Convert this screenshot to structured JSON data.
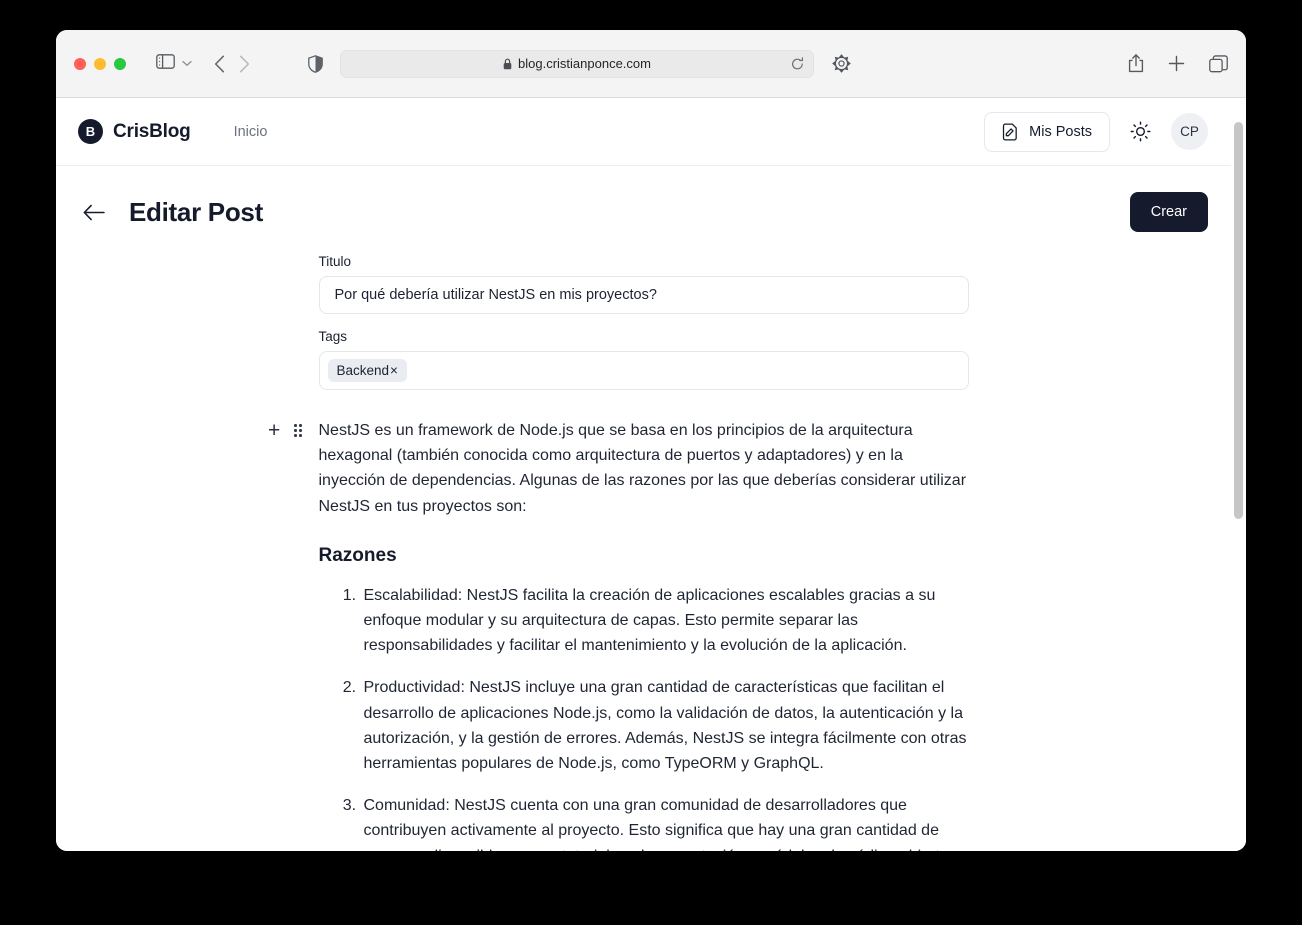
{
  "browser": {
    "url": "blog.cristianponce.com",
    "icons": {
      "sidebar": "sidebar-toggle-icon",
      "chevron": "chevron-down-icon",
      "back": "back-arrow-icon",
      "forward": "forward-arrow-icon",
      "shield": "shield-privacy-icon",
      "lock": "lock-icon",
      "reload": "reload-icon",
      "gear": "gear-icon",
      "share": "share-icon",
      "new_tab": "plus-icon",
      "tabs": "tabs-overview-icon"
    }
  },
  "site_header": {
    "brand_badge": "B",
    "brand_name": "CrisBlog",
    "nav_link": "Inicio",
    "my_posts_label": "Mis Posts",
    "theme_icon": "sun-icon",
    "avatar_initials": "CP"
  },
  "page": {
    "title": "Editar Post",
    "create_button": "Crear"
  },
  "form": {
    "title_label": "Titulo",
    "title_value": "Por qué debería utilizar NestJS en mis proyectos?",
    "tags_label": "Tags",
    "tags": [
      {
        "label": "Backend",
        "remove": "×"
      }
    ]
  },
  "editor": {
    "add_block": "+",
    "intro_paragraph": "NestJS es un framework de Node.js que se basa en los principios de la arquitectura hexagonal (también conocida como arquitectura de puertos y adaptadores) y en la inyección de dependencias. Algunas de las razones por las que deberías considerar utilizar NestJS en tus proyectos son:",
    "heading": "Razones",
    "list_items": [
      "Escalabilidad: NestJS facilita la creación de aplicaciones escalables gracias a su enfoque modular y su arquitectura de capas. Esto permite separar las responsabilidades y facilitar el mantenimiento y la evolución de la aplicación.",
      "Productividad: NestJS incluye una gran cantidad de características que facilitan el desarrollo de aplicaciones Node.js, como la validación de datos, la autenticación y la autorización, y la gestión de errores. Además, NestJS se integra fácilmente con otras herramientas populares de Node.js, como TypeORM y GraphQL.",
      "Comunidad: NestJS cuenta con una gran comunidad de desarrolladores que contribuyen activamente al proyecto. Esto significa que hay una gran cantidad de recursos disponibles, como tutoriales, documentación y módulos de código abierto."
    ]
  },
  "colors": {
    "brand_dark": "#151b2d",
    "chip_bg": "#e9ecf1",
    "text": "#1f2533"
  }
}
